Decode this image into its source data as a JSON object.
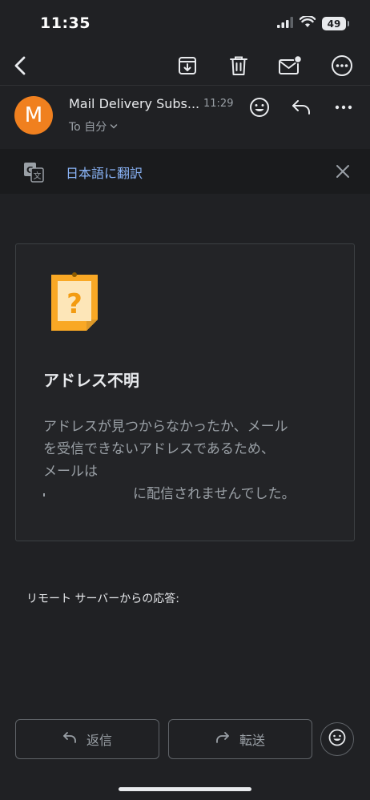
{
  "status_bar": {
    "time": "11:35",
    "battery": "49",
    "icons": [
      "signal-icon",
      "wifi-icon",
      "battery-icon"
    ]
  },
  "toolbar": {
    "icons": [
      "back-icon",
      "archive-icon",
      "trash-icon",
      "mark-unread-icon",
      "more-icon"
    ]
  },
  "header": {
    "avatar_letter": "M",
    "sender": "Mail Delivery Subs...",
    "time": "11:29",
    "recipient": "To 自分"
  },
  "translate": {
    "label": "日本語に翻訳"
  },
  "card": {
    "title": "アドレス不明",
    "line1": "アドレスが見つからなかったか、メール",
    "line2": "を受信できないアドレスであるため、",
    "line3": "メールは",
    "line4": "に配信されませんでした。"
  },
  "response_label": "リモート サーバーからの応答:",
  "actions": {
    "reply_label": "返信",
    "forward_label": "転送"
  },
  "colors": {
    "background": "#202124",
    "avatar": "#f0801f",
    "link": "#8ab4f8",
    "note_icon": "#f9a825"
  }
}
